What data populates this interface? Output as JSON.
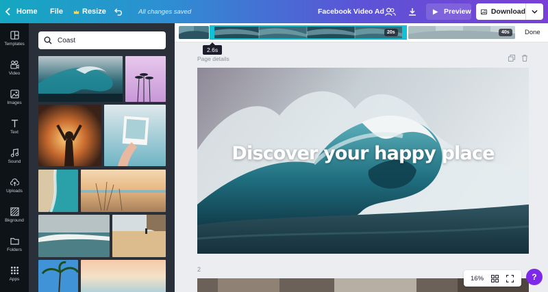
{
  "topbar": {
    "home_label": "Home",
    "file_label": "File",
    "resize_label": "Resize",
    "save_status": "All changes saved",
    "doc_title": "Facebook Video Ad",
    "preview_label": "Preview",
    "download_label": "Download"
  },
  "rail": {
    "items": [
      {
        "label": "Templates",
        "icon": "templates-icon"
      },
      {
        "label": "Video",
        "icon": "video-icon"
      },
      {
        "label": "Images",
        "icon": "images-icon"
      },
      {
        "label": "Text",
        "icon": "text-icon"
      },
      {
        "label": "Sound",
        "icon": "sound-icon"
      },
      {
        "label": "Uploads",
        "icon": "uploads-icon"
      },
      {
        "label": "Bkground",
        "icon": "background-icon"
      },
      {
        "label": "Folders",
        "icon": "folders-icon"
      },
      {
        "label": "Apps",
        "icon": "apps-icon"
      }
    ]
  },
  "panel": {
    "search_value": "Coast"
  },
  "timeline": {
    "playhead_time": "2.6s",
    "segment_1_duration": "20s",
    "segment_2_duration": "40s",
    "done_label": "Done"
  },
  "canvas": {
    "page_details_label": "Page details",
    "headline": "Discover your happy place",
    "page_2_number": "2"
  },
  "zoom": {
    "level": "16%"
  },
  "help": {
    "label": "?"
  },
  "colors": {
    "accent_cyan": "#12c2d4",
    "help_purple": "#7d2ae8",
    "rail_bg": "#0e1318",
    "panel_bg": "#293039"
  }
}
